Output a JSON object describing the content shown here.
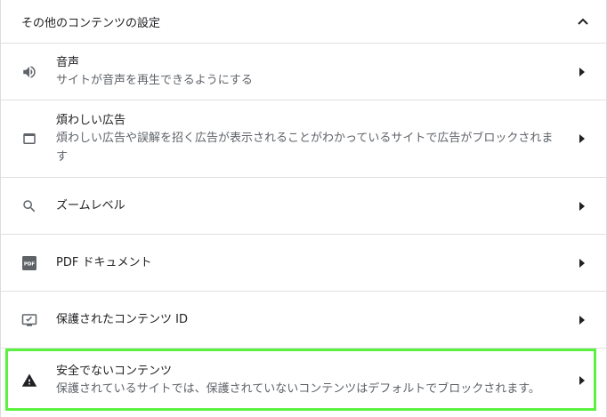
{
  "section": {
    "title": "その他のコンテンツの設定",
    "expanded": true
  },
  "items": [
    {
      "label": "音声",
      "sub": "サイトが音声を再生できるようにする",
      "icon": "volume-icon"
    },
    {
      "label": "煩わしい広告",
      "sub": "煩わしい広告や誤解を招く広告が表示されることがわかっているサイトで広告がブロックされます",
      "icon": "window-icon"
    },
    {
      "label": "ズームレベル",
      "sub": "",
      "icon": "search-icon"
    },
    {
      "label": "PDF ドキュメント",
      "sub": "",
      "icon": "pdf-icon",
      "icon_text": "PDF"
    },
    {
      "label": "保護されたコンテンツ ID",
      "sub": "",
      "icon": "protected-content-icon"
    },
    {
      "label": "安全でないコンテンツ",
      "sub": "保護されているサイトでは、保護されていないコンテンツはデフォルトでブロックされます。",
      "icon": "warning-icon"
    }
  ],
  "colors": {
    "highlight": "#5af13f",
    "text": "#202124",
    "secondary": "#5f6368",
    "icon": "#5f6368",
    "divider": "#e0e0e0"
  }
}
